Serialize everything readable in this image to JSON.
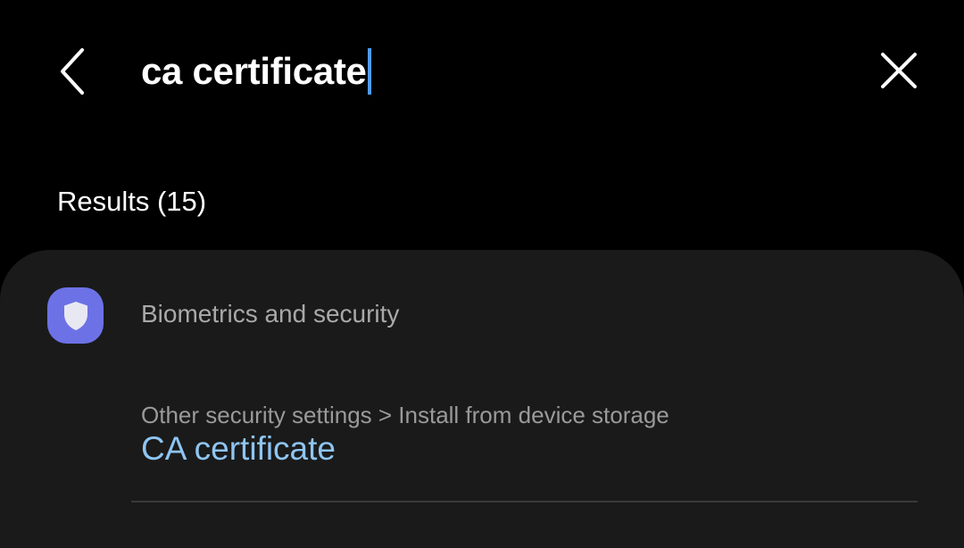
{
  "search": {
    "query": "ca certificate",
    "back_icon": "chevron-left-icon",
    "clear_icon": "close-icon",
    "caret_color": "#4f9bf0"
  },
  "results": {
    "header": "Results (15)"
  },
  "result_group": {
    "category": "Biometrics and security",
    "category_icon": "shield-icon",
    "icon_color": "#6c72e6",
    "items": [
      {
        "path": "Other security settings > Install from device storage",
        "title": "CA certificate",
        "title_color": "#8ec5f2"
      }
    ]
  }
}
